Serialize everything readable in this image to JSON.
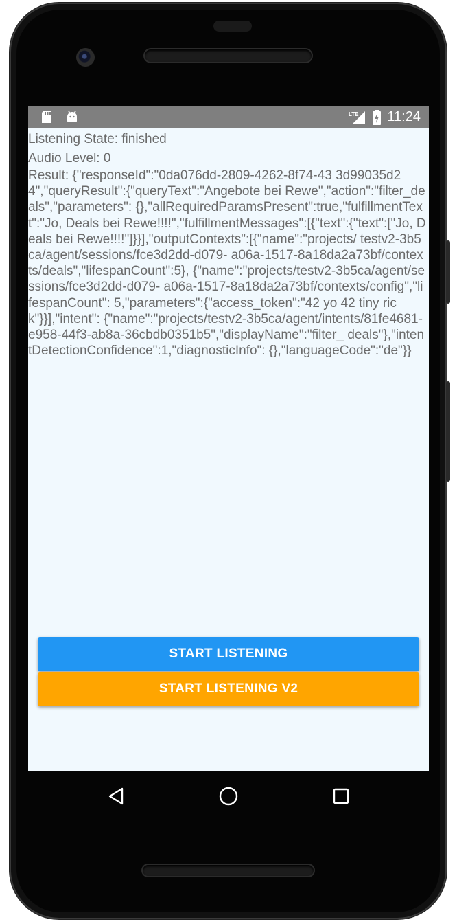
{
  "status_bar": {
    "time": "11:24",
    "left_icons": [
      "sd-card-icon",
      "android-debug-icon"
    ],
    "right_icons": [
      "lte-signal-icon",
      "battery-charging-icon"
    ],
    "network_label": "LTE"
  },
  "app": {
    "listening_state": "Listening State: finished",
    "audio_level": "Audio Level: 0",
    "result_text": "Result: {\"responseId\":\"0da076dd-2809-4262-8f74-43 3d99035d24\",\"queryResult\":{\"queryText\":\"Angebote bei Rewe\",\"action\":\"filter_deals\",\"parameters\": {},\"allRequiredParamsPresent\":true,\"fulfillmentText\":\"Jo, Deals bei Rewe!!!!\",\"fulfillmentMessages\":[{\"text\":{\"text\":[\"Jo, Deals bei Rewe!!!!\"]}}],\"outputContexts\":[{\"name\":\"projects/ testv2-3b5ca/agent/sessions/fce3d2dd-d079- a06a-1517-8a18da2a73bf/contexts/deals\",\"lifespanCount\":5}, {\"name\":\"projects/testv2-3b5ca/agent/sessions/fce3d2dd-d079- a06a-1517-8a18da2a73bf/contexts/config\",\"lifespanCount\": 5,\"parameters\":{\"access_token\":\"42 yo 42 tiny rick\"}}],\"intent\": {\"name\":\"projects/testv2-3b5ca/agent/intents/81fe4681- e958-44f3-ab8a-36cbdb0351b5\",\"displayName\":\"filter_ deals\"},\"intentDetectionConfidence\":1,\"diagnosticInfo\": {},\"languageCode\":\"de\"}}",
    "start_button": "START LISTENING",
    "start_v2_button": "START LISTENING V2"
  },
  "colors": {
    "status_bar": "#7f7f7f",
    "screen_bg": "#f1f9fe",
    "text": "#6b6b6b",
    "button_blue": "#2196f3",
    "button_orange": "#ffa500"
  },
  "navigation": {
    "back": "back-triangle-icon",
    "home": "home-circle-icon",
    "recents": "recents-square-icon"
  }
}
